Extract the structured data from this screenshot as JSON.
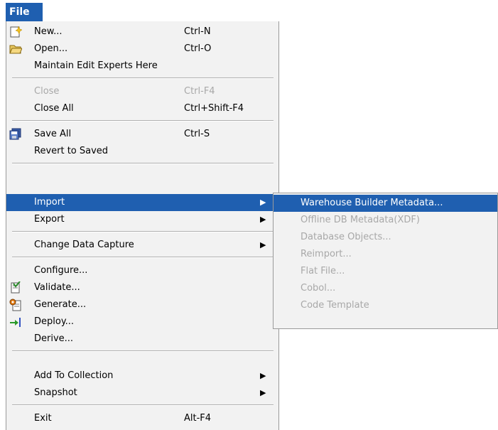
{
  "menubar": {
    "file_label": "File"
  },
  "file_menu": {
    "new": {
      "label": "New...",
      "accelerator": "Ctrl-N",
      "icon": "new-file-icon"
    },
    "open": {
      "label": "Open...",
      "accelerator": "Ctrl-O",
      "icon": "folder-open-icon"
    },
    "maintain": {
      "label": "Maintain Edit Experts Here"
    },
    "close": {
      "label": "Close",
      "accelerator": "Ctrl-F4"
    },
    "close_all": {
      "label": "Close All",
      "accelerator": "Ctrl+Shift-F4"
    },
    "save_all": {
      "label": "Save All",
      "accelerator": "Ctrl-S",
      "icon": "save-all-icon"
    },
    "revert": {
      "label": "Revert to Saved"
    },
    "import": {
      "label": "Import"
    },
    "export": {
      "label": "Export"
    },
    "change_data_capture": {
      "label": "Change Data Capture"
    },
    "configure": {
      "label": "Configure..."
    },
    "validate": {
      "label": "Validate...",
      "icon": "validate-icon"
    },
    "generate": {
      "label": "Generate...",
      "icon": "generate-icon"
    },
    "deploy": {
      "label": "Deploy...",
      "icon": "deploy-icon"
    },
    "derive": {
      "label": "Derive..."
    },
    "add_to_collection": {
      "label": "Add To Collection"
    },
    "snapshot": {
      "label": "Snapshot"
    },
    "exit": {
      "label": "Exit",
      "accelerator": "Alt-F4"
    },
    "submenu_arrow": "▶"
  },
  "import_submenu": {
    "items": [
      {
        "label": "Warehouse Builder Metadata..."
      },
      {
        "label": "Offline DB Metadata(XDF)"
      },
      {
        "label": "Database Objects..."
      },
      {
        "label": "Reimport..."
      },
      {
        "label": "Flat File..."
      },
      {
        "label": "Cobol..."
      },
      {
        "label": "Code Template"
      }
    ]
  },
  "colors": {
    "selection": "#1f5fb0",
    "menu_bg": "#f2f2f2",
    "disabled_text": "#a8a8a8"
  }
}
